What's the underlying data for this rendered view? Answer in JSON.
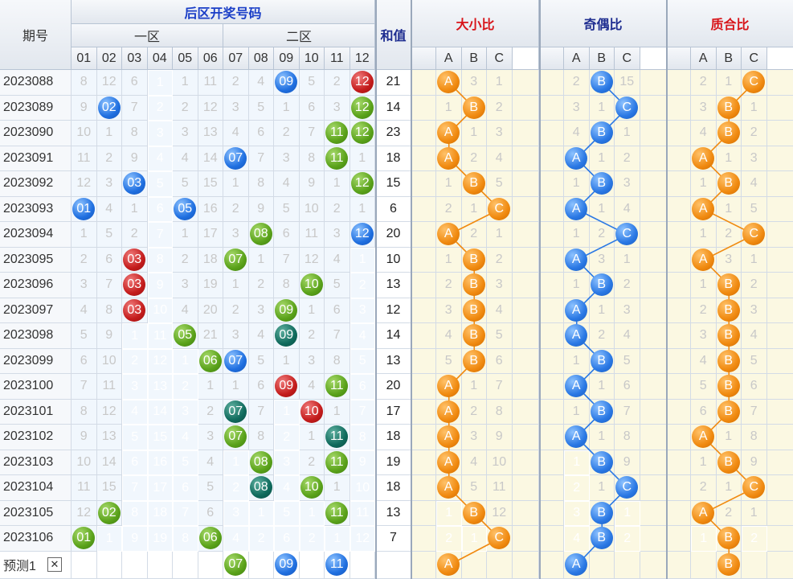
{
  "header": {
    "period": "期号",
    "back_area": "后区开奖号码",
    "zone1": "一区",
    "zone2": "二区",
    "sum": "和值",
    "size_ratio": "大小比",
    "parity_ratio": "奇偶比",
    "prime_ratio": "质合比",
    "nums": [
      "01",
      "02",
      "03",
      "04",
      "05",
      "06",
      "07",
      "08",
      "09",
      "10",
      "11",
      "12"
    ],
    "abc": [
      "A",
      "B",
      "C"
    ]
  },
  "colors": {
    "blue": "#1f6fe0",
    "red": "#c41c1c",
    "green": "#5aa21a",
    "teal": "#0f6a5c",
    "orange": "#f08a10",
    "gray": "#8d8d8d"
  },
  "rows": [
    {
      "period": "2023088",
      "cells": [
        "8",
        "12",
        "6",
        {
          "g": "1"
        },
        "1",
        "11",
        "2",
        "4",
        {
          "b": "09",
          "c": "blue"
        },
        "5",
        "2",
        {
          "b": "12",
          "c": "red"
        }
      ],
      "sum": "21",
      "size": [
        {
          "b": "A"
        },
        "3",
        "1"
      ],
      "parity": [
        "2",
        {
          "b": "B"
        },
        "15"
      ],
      "prime": [
        "2",
        "1",
        {
          "b": "C"
        }
      ]
    },
    {
      "period": "2023089",
      "cells": [
        "9",
        {
          "b": "02",
          "c": "blue"
        },
        "7",
        {
          "g": "2"
        },
        "2",
        "12",
        "3",
        "5",
        "1",
        "6",
        "3",
        {
          "b": "12",
          "c": "green"
        }
      ],
      "sum": "14",
      "size": [
        "1",
        {
          "b": "B"
        },
        "2"
      ],
      "parity": [
        "3",
        "1",
        {
          "b": "C"
        }
      ],
      "prime": [
        "3",
        {
          "b": "B"
        },
        "1"
      ]
    },
    {
      "period": "2023090",
      "cells": [
        "10",
        "1",
        "8",
        {
          "g": "3"
        },
        "3",
        "13",
        "4",
        "6",
        "2",
        "7",
        {
          "b": "11",
          "c": "green"
        },
        {
          "b": "12",
          "c": "green"
        }
      ],
      "sum": "23",
      "size": [
        {
          "b": "A"
        },
        "1",
        "3"
      ],
      "parity": [
        "4",
        {
          "b": "B"
        },
        "1"
      ],
      "prime": [
        "4",
        {
          "b": "B"
        },
        "2"
      ]
    },
    {
      "period": "2023091",
      "cells": [
        "11",
        "2",
        "9",
        {
          "g": "4"
        },
        "4",
        "14",
        {
          "b": "07",
          "c": "blue"
        },
        "7",
        "3",
        "8",
        {
          "b": "11",
          "c": "green"
        },
        "1"
      ],
      "sum": "18",
      "size": [
        {
          "b": "A"
        },
        "2",
        "4"
      ],
      "parity": [
        {
          "b": "A"
        },
        "1",
        "2"
      ],
      "prime": [
        {
          "b": "A"
        },
        "1",
        "3"
      ]
    },
    {
      "period": "2023092",
      "cells": [
        "12",
        "3",
        {
          "b": "03",
          "c": "blue"
        },
        {
          "g": "5"
        },
        "5",
        "15",
        "1",
        "8",
        "4",
        "9",
        "1",
        {
          "b": "12",
          "c": "green"
        }
      ],
      "sum": "15",
      "size": [
        "1",
        {
          "b": "B"
        },
        "5"
      ],
      "parity": [
        "1",
        {
          "b": "B"
        },
        "3"
      ],
      "prime": [
        "1",
        {
          "b": "B"
        },
        "4"
      ]
    },
    {
      "period": "2023093",
      "cells": [
        {
          "b": "01",
          "c": "blue"
        },
        "4",
        "1",
        {
          "g": "6"
        },
        {
          "b": "05",
          "c": "blue"
        },
        "16",
        "2",
        "9",
        "5",
        "10",
        "2",
        "1"
      ],
      "sum": "6",
      "size": [
        "2",
        "1",
        {
          "b": "C"
        }
      ],
      "parity": [
        {
          "b": "A"
        },
        "1",
        "4"
      ],
      "prime": [
        {
          "b": "A"
        },
        "1",
        "5"
      ]
    },
    {
      "period": "2023094",
      "cells": [
        "1",
        "5",
        "2",
        {
          "g": "7"
        },
        "1",
        "17",
        "3",
        {
          "b": "08",
          "c": "green"
        },
        "6",
        "11",
        "3",
        {
          "b": "12",
          "c": "blue"
        }
      ],
      "sum": "20",
      "size": [
        {
          "b": "A"
        },
        "2",
        "1"
      ],
      "parity": [
        "1",
        "2",
        {
          "b": "C"
        }
      ],
      "prime": [
        "1",
        "2",
        {
          "b": "C"
        }
      ]
    },
    {
      "period": "2023095",
      "cells": [
        "2",
        "6",
        {
          "b": "03",
          "c": "red"
        },
        {
          "g": "8"
        },
        "2",
        "18",
        {
          "b": "07",
          "c": "green"
        },
        "1",
        "7",
        "12",
        "4",
        {
          "g": "1"
        }
      ],
      "sum": "10",
      "size": [
        "1",
        {
          "b": "B"
        },
        "2"
      ],
      "parity": [
        {
          "b": "A"
        },
        "3",
        "1"
      ],
      "prime": [
        {
          "b": "A"
        },
        "3",
        "1"
      ]
    },
    {
      "period": "2023096",
      "cells": [
        "3",
        "7",
        {
          "b": "03",
          "c": "red"
        },
        {
          "g": "9"
        },
        "3",
        "19",
        "1",
        "2",
        "8",
        {
          "b": "10",
          "c": "green"
        },
        "5",
        {
          "g": "2"
        }
      ],
      "sum": "13",
      "size": [
        "2",
        {
          "b": "B"
        },
        "3"
      ],
      "parity": [
        "1",
        {
          "b": "B"
        },
        "2"
      ],
      "prime": [
        "1",
        {
          "b": "B"
        },
        "2"
      ]
    },
    {
      "period": "2023097",
      "cells": [
        "4",
        "8",
        {
          "b": "03",
          "c": "red"
        },
        {
          "g": "10"
        },
        "4",
        "20",
        "2",
        "3",
        {
          "b": "09",
          "c": "green"
        },
        "1",
        "6",
        {
          "g": "3"
        }
      ],
      "sum": "12",
      "size": [
        "3",
        {
          "b": "B"
        },
        "4"
      ],
      "parity": [
        {
          "b": "A"
        },
        "1",
        "3"
      ],
      "prime": [
        "2",
        {
          "b": "B"
        },
        "3"
      ]
    },
    {
      "period": "2023098",
      "cells": [
        "5",
        "9",
        {
          "g": "1"
        },
        {
          "g": "11"
        },
        {
          "b": "05",
          "c": "green"
        },
        "21",
        "3",
        "4",
        {
          "b": "09",
          "c": "teal"
        },
        "2",
        "7",
        {
          "g": "4"
        }
      ],
      "sum": "14",
      "size": [
        "4",
        {
          "b": "B"
        },
        "5"
      ],
      "parity": [
        {
          "b": "A"
        },
        "2",
        "4"
      ],
      "prime": [
        "3",
        {
          "b": "B"
        },
        "4"
      ]
    },
    {
      "period": "2023099",
      "cells": [
        "6",
        "10",
        {
          "g": "2"
        },
        {
          "g": "12"
        },
        {
          "g": "1"
        },
        {
          "b": "06",
          "c": "green"
        },
        {
          "b": "07",
          "c": "blue"
        },
        "5",
        "1",
        "3",
        "8",
        {
          "g": "5"
        }
      ],
      "sum": "13",
      "size": [
        "5",
        {
          "b": "B"
        },
        "6"
      ],
      "parity": [
        "1",
        {
          "b": "B"
        },
        "5"
      ],
      "prime": [
        "4",
        {
          "b": "B"
        },
        "5"
      ]
    },
    {
      "period": "2023100",
      "cells": [
        "7",
        "11",
        {
          "g": "3"
        },
        {
          "g": "13"
        },
        {
          "g": "2"
        },
        "1",
        "1",
        "6",
        {
          "b": "09",
          "c": "red"
        },
        "4",
        {
          "b": "11",
          "c": "green"
        },
        {
          "g": "6"
        }
      ],
      "sum": "20",
      "size": [
        {
          "b": "A"
        },
        "1",
        "7"
      ],
      "parity": [
        {
          "b": "A"
        },
        "1",
        "6"
      ],
      "prime": [
        "5",
        {
          "b": "B"
        },
        "6"
      ]
    },
    {
      "period": "2023101",
      "cells": [
        "8",
        "12",
        {
          "g": "4"
        },
        {
          "g": "14"
        },
        {
          "g": "3"
        },
        "2",
        {
          "b": "07",
          "c": "teal"
        },
        "7",
        {
          "g": "1"
        },
        {
          "b": "10",
          "c": "red"
        },
        "1",
        {
          "g": "7"
        }
      ],
      "sum": "17",
      "size": [
        {
          "b": "A"
        },
        "2",
        "8"
      ],
      "parity": [
        "1",
        {
          "b": "B"
        },
        "7"
      ],
      "prime": [
        "6",
        {
          "b": "B"
        },
        "7"
      ]
    },
    {
      "period": "2023102",
      "cells": [
        "9",
        "13",
        {
          "g": "5"
        },
        {
          "g": "15"
        },
        {
          "g": "4"
        },
        "3",
        {
          "b": "07",
          "c": "green"
        },
        "8",
        {
          "g": "2"
        },
        "1",
        {
          "b": "11",
          "c": "teal"
        },
        {
          "g": "8"
        }
      ],
      "sum": "18",
      "size": [
        {
          "b": "A"
        },
        "3",
        "9"
      ],
      "parity": [
        {
          "b": "A"
        },
        "1",
        "8"
      ],
      "prime": [
        {
          "b": "A"
        },
        "1",
        "8"
      ]
    },
    {
      "period": "2023103",
      "cells": [
        "10",
        "14",
        {
          "g": "6"
        },
        {
          "g": "16"
        },
        {
          "g": "5"
        },
        "4",
        {
          "g": "1"
        },
        {
          "b": "08",
          "c": "green"
        },
        {
          "g": "3"
        },
        "2",
        {
          "b": "11",
          "c": "green"
        },
        {
          "g": "9"
        }
      ],
      "sum": "19",
      "size": [
        {
          "b": "A"
        },
        "4",
        "10"
      ],
      "parity": [
        {
          "g": "1"
        },
        {
          "b": "B"
        },
        "9"
      ],
      "prime": [
        "1",
        {
          "b": "B"
        },
        "9"
      ]
    },
    {
      "period": "2023104",
      "cells": [
        "11",
        "15",
        {
          "g": "7"
        },
        {
          "g": "17"
        },
        {
          "g": "6"
        },
        "5",
        {
          "g": "2"
        },
        {
          "b": "08",
          "c": "teal"
        },
        {
          "g": "4"
        },
        {
          "b": "10",
          "c": "green"
        },
        "1",
        {
          "g": "10"
        }
      ],
      "sum": "18",
      "size": [
        {
          "b": "A"
        },
        "5",
        "11"
      ],
      "parity": [
        {
          "g": "2"
        },
        "1",
        {
          "b": "C"
        }
      ],
      "prime": [
        "2",
        "1",
        {
          "b": "C"
        }
      ]
    },
    {
      "period": "2023105",
      "cells": [
        "12",
        {
          "b": "02",
          "c": "green"
        },
        {
          "g": "8"
        },
        {
          "g": "18"
        },
        {
          "g": "7"
        },
        "6",
        {
          "g": "3"
        },
        {
          "g": "1"
        },
        {
          "g": "5"
        },
        {
          "g": "1"
        },
        {
          "b": "11",
          "c": "green"
        },
        {
          "g": "11"
        }
      ],
      "sum": "13",
      "size": [
        {
          "g": "1"
        },
        {
          "b": "B"
        },
        "12"
      ],
      "parity": [
        {
          "g": "3"
        },
        {
          "b": "B"
        },
        {
          "g": "1"
        }
      ],
      "prime": [
        {
          "b": "A"
        },
        "2",
        "1"
      ]
    },
    {
      "period": "2023106",
      "cells": [
        {
          "b": "01",
          "c": "green"
        },
        {
          "g": "1"
        },
        {
          "g": "9"
        },
        {
          "g": "19"
        },
        {
          "g": "8"
        },
        {
          "b": "06",
          "c": "green"
        },
        {
          "g": "4"
        },
        {
          "g": "2"
        },
        {
          "g": "6"
        },
        {
          "g": "2"
        },
        {
          "g": "1"
        },
        {
          "g": "12"
        }
      ],
      "sum": "7",
      "size": [
        {
          "g": "2"
        },
        {
          "g": "1"
        },
        {
          "b": "C"
        }
      ],
      "parity": [
        {
          "g": "4"
        },
        {
          "b": "B"
        },
        {
          "g": "2"
        }
      ],
      "prime": [
        {
          "g": "1"
        },
        {
          "b": "B"
        },
        {
          "g": "2"
        }
      ]
    }
  ],
  "predict": {
    "label": "预测1",
    "close": "✕",
    "balls": {
      "6": "07",
      "8": "09",
      "10": "11"
    },
    "size": "A",
    "parity": "A",
    "prime": "B"
  }
}
